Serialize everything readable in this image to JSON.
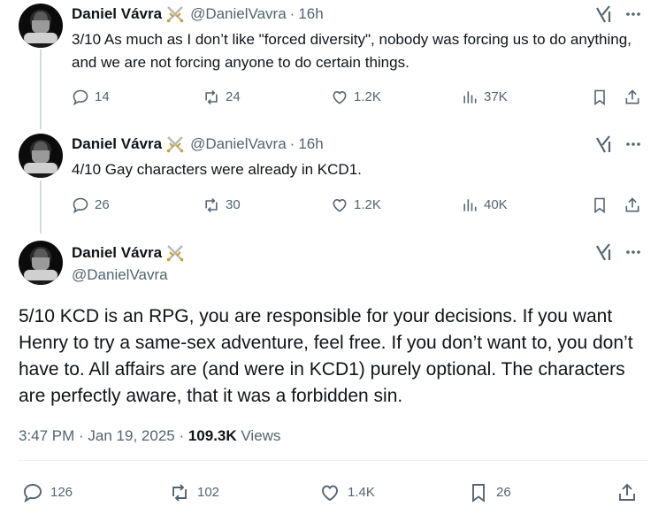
{
  "tweets": [
    {
      "name": "Daniel Vávra",
      "badge_icon": "crossed-swords-icon",
      "handle": "@DanielVavra",
      "separator": "·",
      "time": "16h",
      "text": "3/10 As much as I don’t like \"forced diversity\", nobody was forcing us to do anything, and we are not forcing anyone to do certain things.",
      "replies": "14",
      "reposts": "24",
      "likes": "1.2K",
      "views": "37K"
    },
    {
      "name": "Daniel Vávra",
      "badge_icon": "crossed-swords-icon",
      "handle": "@DanielVavra",
      "separator": "·",
      "time": "16h",
      "text": "4/10 Gay characters were already in KCD1.",
      "replies": "26",
      "reposts": "30",
      "likes": "1.2K",
      "views": "40K"
    }
  ],
  "main_tweet": {
    "name": "Daniel Vávra",
    "badge_icon": "crossed-swords-icon",
    "handle": "@DanielVavra",
    "text": "5/10 KCD is an RPG, you are responsible for your decisions. If you want Henry to try a same-sex adventure, feel free. If you don’t want to, you don’t have to. All affairs are (and were in KCD1) purely optional. The characters are perfectly aware, that it was a forbidden sin.",
    "timestamp": "3:47 PM · Jan 19, 2025 · ",
    "views_count": "109.3K",
    "views_label": " Views",
    "replies": "126",
    "reposts": "102",
    "likes": "1.4K",
    "bookmarks": "26"
  },
  "colors": {
    "text": "#0f1419",
    "secondary": "#536471",
    "thread_line": "#cfd9de",
    "badge_gold": "#c9a227"
  }
}
